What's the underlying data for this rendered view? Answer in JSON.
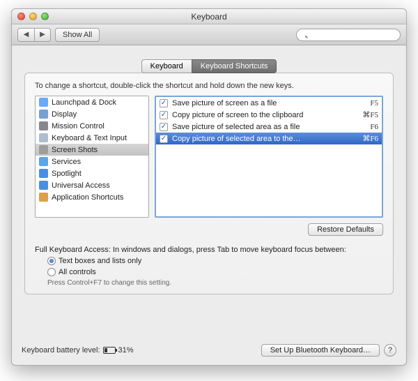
{
  "window": {
    "title": "Keyboard"
  },
  "toolbar": {
    "show_all": "Show All",
    "search_placeholder": ""
  },
  "tabs": {
    "keyboard": "Keyboard",
    "shortcuts": "Keyboard Shortcuts"
  },
  "hint": "To change a shortcut, double-click the shortcut and hold down the new keys.",
  "categories": [
    {
      "label": "Launchpad & Dock",
      "color": "#6aa9ff"
    },
    {
      "label": "Display",
      "color": "#77a0cf"
    },
    {
      "label": "Mission Control",
      "color": "#86878e"
    },
    {
      "label": "Keyboard & Text Input",
      "color": "#aebdd1"
    },
    {
      "label": "Screen Shots",
      "color": "#9d9d9d",
      "selected": true
    },
    {
      "label": "Services",
      "color": "#5aa6e6"
    },
    {
      "label": "Spotlight",
      "color": "#4c8de4"
    },
    {
      "label": "Universal Access",
      "color": "#4c8de4"
    },
    {
      "label": "Application Shortcuts",
      "color": "#d9a24a"
    }
  ],
  "shortcuts": [
    {
      "checked": true,
      "label": "Save picture of screen as a file",
      "key": "F5"
    },
    {
      "checked": true,
      "label": "Copy picture of screen to the clipboard",
      "key": "⌘F5"
    },
    {
      "checked": true,
      "label": "Save picture of selected area as a file",
      "key": "F6"
    },
    {
      "checked": true,
      "label": "Copy picture of selected area to the…",
      "key": "⌘F6",
      "selected": true
    }
  ],
  "restore": "Restore Defaults",
  "access": {
    "label": "Full Keyboard Access: In windows and dialogs, press Tab to move keyboard focus between:",
    "opt1": "Text boxes and lists only",
    "opt2": "All controls",
    "hint": "Press Control+F7 to change this setting."
  },
  "footer": {
    "battery_label": "Keyboard battery level:",
    "battery_pct": "31%",
    "bluetooth": "Set Up Bluetooth Keyboard…",
    "help": "?"
  }
}
